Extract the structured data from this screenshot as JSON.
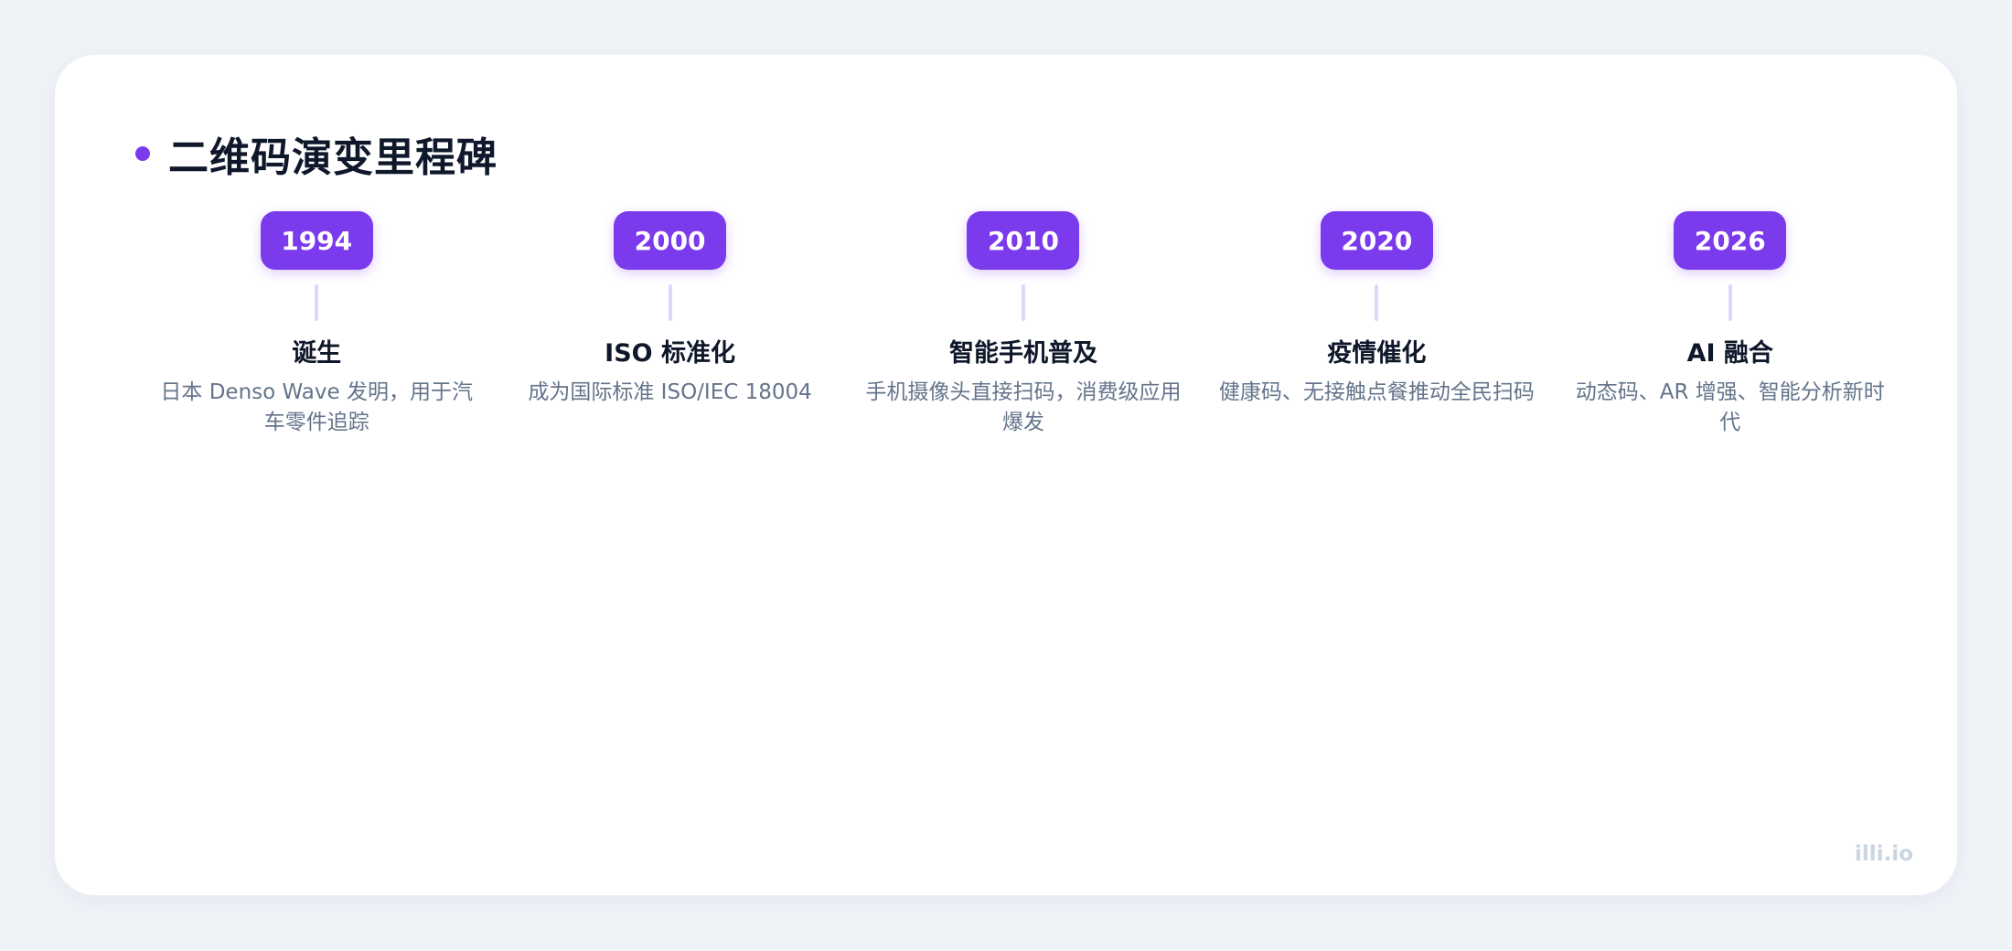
{
  "title": "二维码演变里程碑",
  "milestones": [
    {
      "year": "1994",
      "title": "诞生",
      "desc": "日本 Denso Wave 发明，用于汽车零件追踪"
    },
    {
      "year": "2000",
      "title": "ISO 标准化",
      "desc": "成为国际标准 ISO/IEC 18004"
    },
    {
      "year": "2010",
      "title": "智能手机普及",
      "desc": "手机摄像头直接扫码，消费级应用爆发"
    },
    {
      "year": "2020",
      "title": "疫情催化",
      "desc": "健康码、无接触点餐推动全民扫码"
    },
    {
      "year": "2026",
      "title": "AI 融合",
      "desc": "动态码、AR 增强、智能分析新时代"
    }
  ],
  "watermark": "illi.io",
  "colors": {
    "accent": "#7c3aed",
    "connector": "#ddd6fe",
    "background": "#eff3f8",
    "card": "#ffffff"
  }
}
